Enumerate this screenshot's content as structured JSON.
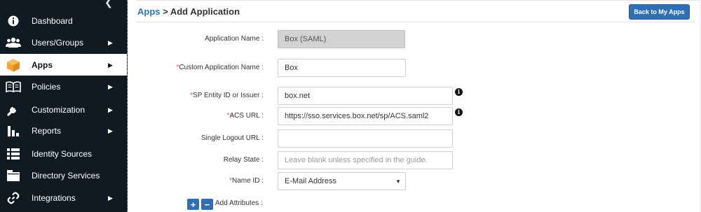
{
  "sidebar": {
    "items": [
      {
        "label": "Dashboard",
        "icon": "info-circle-icon",
        "chevron": false,
        "active": false
      },
      {
        "label": "Users/Groups",
        "icon": "users-icon",
        "chevron": true,
        "active": false
      },
      {
        "label": "Apps",
        "icon": "cube-icon",
        "chevron": true,
        "active": true
      },
      {
        "label": "Policies",
        "icon": "book-icon",
        "chevron": true,
        "active": false
      },
      {
        "label": "Customization",
        "icon": "wrench-icon",
        "chevron": true,
        "active": false
      },
      {
        "label": "Reports",
        "icon": "bar-chart-icon",
        "chevron": true,
        "active": false
      },
      {
        "label": "Identity Sources",
        "icon": "list-icon",
        "chevron": false,
        "active": false
      },
      {
        "label": "Directory Services",
        "icon": "folder-icon",
        "chevron": false,
        "active": false
      },
      {
        "label": "Integrations",
        "icon": "link-icon",
        "chevron": true,
        "active": false
      }
    ],
    "chevron_glyph": "▶",
    "collapse_glyph": "❮"
  },
  "header": {
    "breadcrumb_link": "Apps",
    "breadcrumb_sep": " > ",
    "breadcrumb_current": "Add Application",
    "back_button": "Back to My Apps"
  },
  "form": {
    "application_name": {
      "label": "Application Name :",
      "value": "Box (SAML)",
      "required": false
    },
    "custom_application_name": {
      "label": "Custom Application Name :",
      "value": "Box",
      "required": true
    },
    "sp_entity_id": {
      "label": "SP Entity ID or Issuer :",
      "value": "box.net",
      "required": true
    },
    "acs_url": {
      "label": "ACS URL :",
      "value": "https://sso.services.box.net/sp/ACS.saml2",
      "required": true
    },
    "single_logout_url": {
      "label": "Single Logout URL :",
      "value": "",
      "required": false
    },
    "relay_state": {
      "label": "Relay State :",
      "value": "",
      "placeholder": "Leave blank unless specified in the guide.",
      "required": false
    },
    "name_id": {
      "label": "Name ID :",
      "selected": "E-Mail Address",
      "required": true
    },
    "add_attributes": {
      "label": "Add Attributes :",
      "plus": "+",
      "minus": "−"
    },
    "required_mark": "*",
    "info_glyph": "i"
  },
  "colors": {
    "sidebar_bg": "#0f1a22",
    "accent": "#2f6fb4",
    "required": "#d9534f",
    "apps_icon": "#f2a53a"
  }
}
